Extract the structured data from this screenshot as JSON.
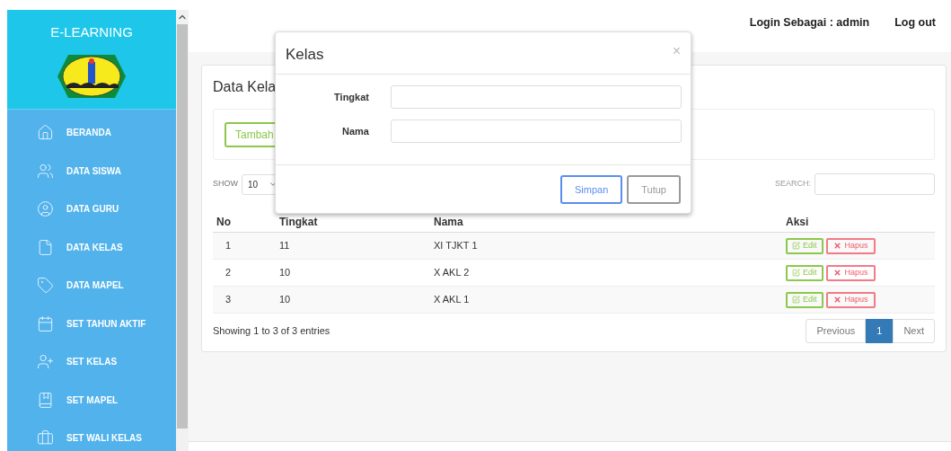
{
  "sidebar": {
    "title": "E-LEARNING",
    "items": [
      {
        "label": "BERANDA"
      },
      {
        "label": "DATA SISWA"
      },
      {
        "label": "DATA GURU"
      },
      {
        "label": "DATA KELAS"
      },
      {
        "label": "DATA MAPEL"
      },
      {
        "label": "SET TAHUN AKTIF"
      },
      {
        "label": "SET KELAS"
      },
      {
        "label": "SET MAPEL"
      },
      {
        "label": "SET WALI KELAS"
      }
    ]
  },
  "topbar": {
    "login": "Login Sebagai : admin",
    "logout": "Log out"
  },
  "card": {
    "title": "Data Kela",
    "add_button": "Tambah",
    "show_label": "SHOW",
    "page_size": "10",
    "search_label": "SEARCH:",
    "columns": [
      "No",
      "Tingkat",
      "Nama",
      "Aksi"
    ],
    "rows": [
      {
        "no": "1",
        "tingkat": "11",
        "nama": "XI TJKT 1",
        "edit": "Edit",
        "delete": "Hapus"
      },
      {
        "no": "2",
        "tingkat": "10",
        "nama": "X AKL 2",
        "edit": "Edit",
        "delete": "Hapus"
      },
      {
        "no": "3",
        "tingkat": "10",
        "nama": "X AKL 1",
        "edit": "Edit",
        "delete": "Hapus"
      }
    ],
    "info": "Showing 1 to 3 of 3 entries",
    "pagination": [
      {
        "label": "Previous",
        "selected": false
      },
      {
        "label": "1",
        "selected": true
      },
      {
        "label": "Next",
        "selected": false
      }
    ]
  },
  "modal": {
    "title": "Kelas",
    "close": "×",
    "fields": [
      {
        "label": "Tingkat"
      },
      {
        "label": "Nama"
      }
    ],
    "buttons": [
      {
        "label": "Simpan",
        "kind": "primary"
      },
      {
        "label": "Tutup",
        "kind": "default"
      }
    ]
  }
}
